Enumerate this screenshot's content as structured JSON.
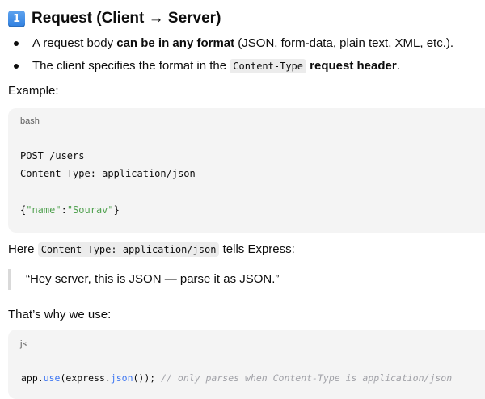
{
  "heading": {
    "keycap": "1",
    "title": "Request (Client → Server)"
  },
  "bullets": [
    {
      "pre": "A request body ",
      "bold": "can be in any format",
      "post": " (JSON, form-data, plain text, XML, etc.)."
    },
    {
      "pre": "The client specifies the format in the ",
      "code": "Content-Type",
      "bold": "request header",
      "post": "."
    }
  ],
  "example_label": "Example:",
  "code1": {
    "lang": "bash",
    "line1": "POST /users",
    "line2": "Content-Type: application/json",
    "line3_open": "{",
    "line3_key": "\"name\"",
    "line3_colon": ":",
    "line3_value": "\"Sourav\"",
    "line3_close": "}"
  },
  "here": {
    "pre": "Here ",
    "code": "Content-Type: application/json",
    "post": " tells Express:"
  },
  "quote": "“Hey server, this is JSON — parse it as JSON.”",
  "why_label": "That’s why we use:",
  "code2": {
    "lang": "js",
    "part1": "app.",
    "fn1": "use",
    "part2": "(express.",
    "fn2": "json",
    "part3": "()); ",
    "comment": "// only parses when Content-Type is application/json"
  }
}
